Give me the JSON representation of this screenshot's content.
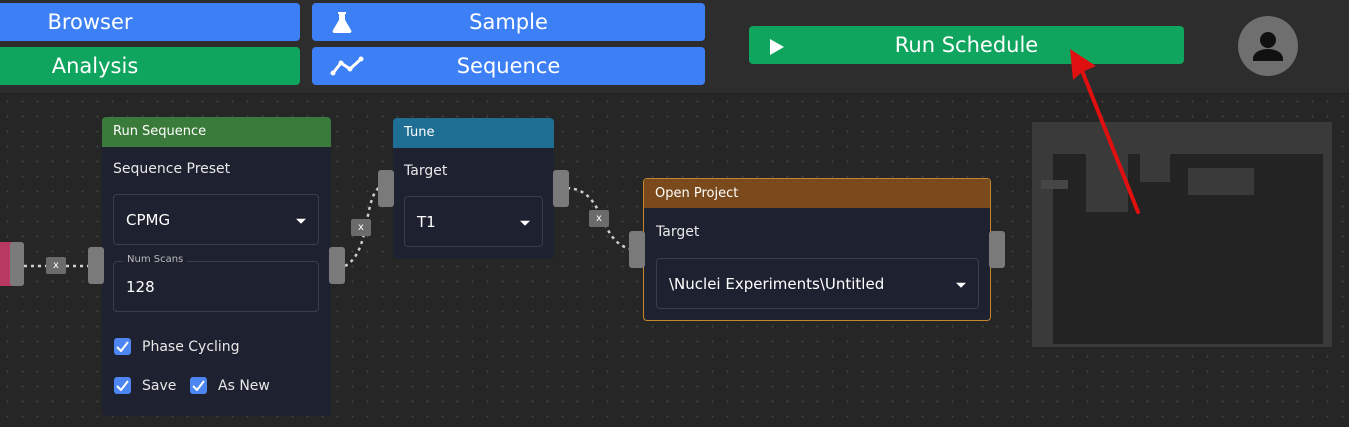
{
  "nav": {
    "browser": "Browser",
    "sample": "Sample",
    "analysis": "Analysis",
    "sequence": "Sequence",
    "run_schedule": "Run Schedule"
  },
  "icons": {
    "sample": "flask-icon",
    "sequence": "line-chart-icon",
    "run": "play-icon",
    "profile": "user-avatar-icon"
  },
  "colors": {
    "blue": "#3d7ff5",
    "green": "#0fa55e",
    "run_sequence_header": "#3a7a3a",
    "tune_header": "#1f6e94",
    "open_project_header": "#7a4a1c",
    "open_project_border": "#c8852e",
    "arrow": "#e01010"
  },
  "nodes": {
    "run_sequence": {
      "title": "Run Sequence",
      "preset_label": "Sequence Preset",
      "preset_value": "CPMG",
      "scans_legend": "Num Scans",
      "scans_value": "128",
      "phase_cycling": "Phase Cycling",
      "save": "Save",
      "as_new": "As New"
    },
    "tune": {
      "title": "Tune",
      "target_label": "Target",
      "target_value": "T1"
    },
    "open_project": {
      "title": "Open Project",
      "target_label": "Target",
      "target_value": "\\Nuclei Experiments\\Untitled"
    }
  },
  "connections": {
    "remove_label": "x"
  }
}
